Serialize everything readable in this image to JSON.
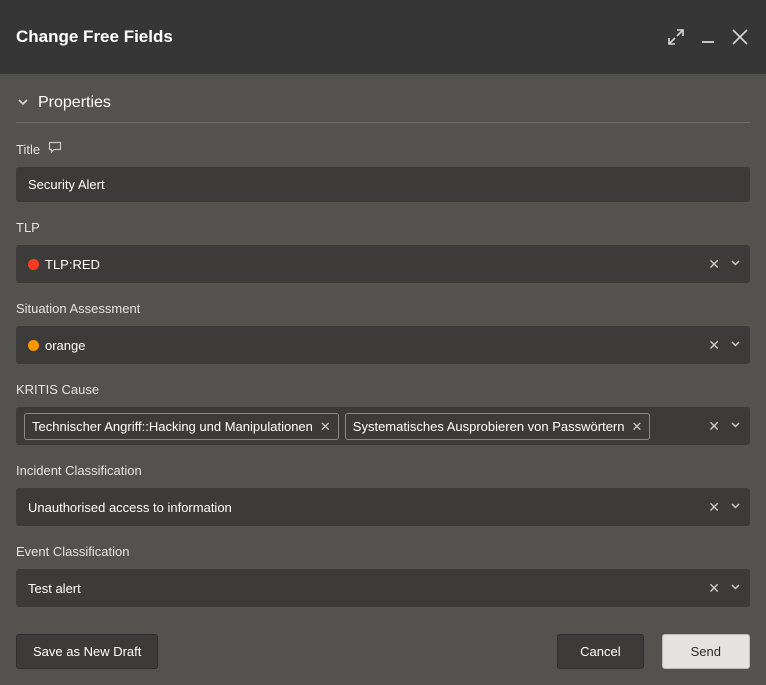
{
  "header": {
    "title": "Change Free Fields"
  },
  "section": {
    "title": "Properties"
  },
  "fields": {
    "title": {
      "label": "Title",
      "value": "Security Alert"
    },
    "tlp": {
      "label": "TLP",
      "value": "TLP:RED",
      "dot_color": "#ff3b1f"
    },
    "situation": {
      "label": "Situation Assessment",
      "value": "orange",
      "dot_color": "#ff9500"
    },
    "kritis": {
      "label": "KRITIS Cause",
      "chips": [
        "Technischer Angriff::Hacking und Manipulationen",
        "Systematisches Ausprobieren von Passwörtern"
      ]
    },
    "incident": {
      "label": "Incident Classification",
      "value": "Unauthorised access to information"
    },
    "event": {
      "label": "Event Classification",
      "value": "Test alert"
    }
  },
  "footer": {
    "draft": "Save as New Draft",
    "cancel": "Cancel",
    "send": "Send"
  }
}
